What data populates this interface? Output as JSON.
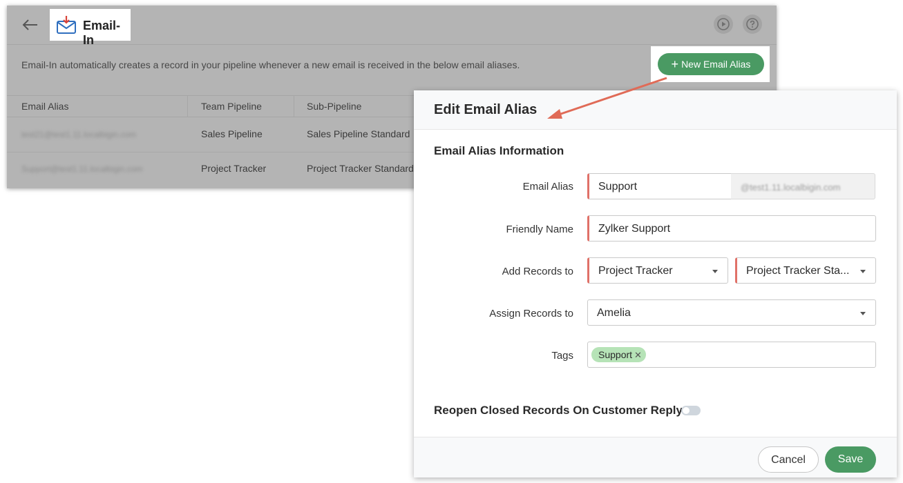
{
  "background_page": {
    "back_icon": "back-arrow-icon",
    "title": "Email-In",
    "title_icon": "email-in-icon",
    "header_icons": [
      "play-icon",
      "help-icon"
    ],
    "description": "Email-In automatically creates a record in your pipeline whenever a new email is received in the below email aliases.",
    "new_alias_button": "New Email Alias",
    "table": {
      "columns": [
        "Email Alias",
        "Team Pipeline",
        "Sub-Pipeline"
      ],
      "rows": [
        {
          "alias": "test21@test1.11.localbigin.com",
          "team_pipeline": "Sales Pipeline",
          "sub_pipeline": "Sales Pipeline Standard"
        },
        {
          "alias": "Support@test1.11.localbigin.com",
          "team_pipeline": "Project Tracker",
          "sub_pipeline": "Project Tracker Standard"
        }
      ]
    }
  },
  "modal": {
    "title": "Edit Email Alias",
    "section_title": "Email Alias Information",
    "fields": {
      "email_alias": {
        "label": "Email Alias",
        "value": "Support",
        "domain": "@test1.11.localbigin.com"
      },
      "friendly_name": {
        "label": "Friendly Name",
        "value": "Zylker Support"
      },
      "add_records_to": {
        "label": "Add Records to",
        "pipeline": "Project Tracker",
        "sub_pipeline": "Project Tracker Sta..."
      },
      "assign_records_to": {
        "label": "Assign Records to",
        "value": "Amelia"
      },
      "tags": {
        "label": "Tags",
        "chips": [
          "Support"
        ]
      }
    },
    "reopen_label": "Reopen Closed Records On Customer Reply",
    "reopen_enabled": false,
    "cancel_label": "Cancel",
    "save_label": "Save"
  },
  "colors": {
    "primary_green": "#4a9a63",
    "required_marker": "#e07168",
    "annotation_arrow": "#e06b57",
    "tag_chip": "#b6e3b7"
  }
}
